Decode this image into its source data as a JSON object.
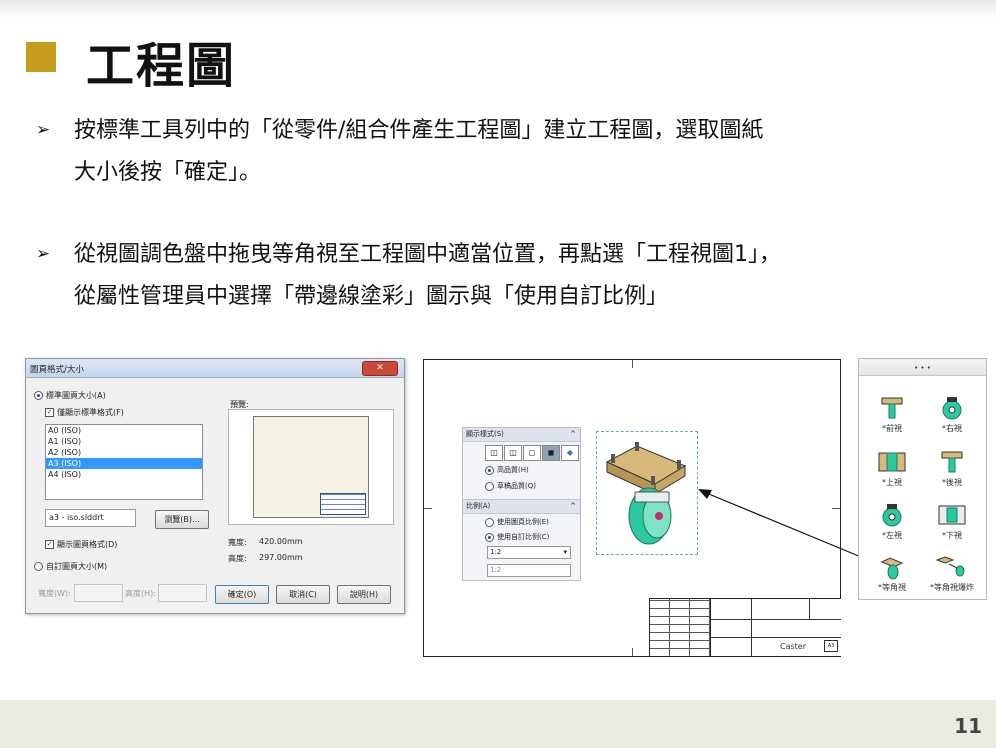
{
  "slide": {
    "title": "工程圖",
    "bullets": [
      {
        "line1": "按標準工具列中的「從零件/組合件產生工程圖」建立工程圖，選取圖紙",
        "line2": "大小後按「確定」。"
      },
      {
        "line1": "從視圖調色盤中拖曳等角視至工程圖中適當位置，再點選「工程視圖1」，",
        "line2": "從屬性管理員中選擇「帶邊線塗彩」圖示與「使用自訂比例」"
      }
    ],
    "bullet_glyph": "➢",
    "page_number": "11"
  },
  "dialog": {
    "title": "圖頁格式/大小",
    "standard_size_label": "標準圖頁大小(A)",
    "only_standard_label": "僅顯示標準格式(F)",
    "sizes": [
      "A0 (ISO)",
      "A1 (ISO)",
      "A2 (ISO)",
      "A3 (ISO)",
      "A4 (ISO)"
    ],
    "selected_index": 3,
    "preview_label": "預覽:",
    "format_file": "a3 - iso.slddrt",
    "browse_label": "瀏覽(B)...",
    "show_format_label": "顯示圖頁格式(D)",
    "width_label": "寬度:",
    "width_value": "420.00mm",
    "height_label": "高度:",
    "height_value": "297.00mm",
    "custom_size_label": "自訂圖頁大小(M)",
    "custom_width_label": "寬度(W):",
    "custom_height_label": "高度(H):",
    "ok_label": "確定(O)",
    "cancel_label": "取消(C)",
    "help_label": "說明(H)",
    "close_glyph": "✕"
  },
  "display_panel": {
    "display_style_header": "顯示樣式(S)",
    "high_quality": "高品質(H)",
    "draft_quality": "草稿品質(Q)",
    "scale_header": "比例(A)",
    "use_sheet_scale": "使用圖頁比例(E)",
    "use_custom_scale": "使用自訂比例(C)",
    "scale_select": "1:2",
    "scale_field": "1:2",
    "chevron": "^"
  },
  "title_block": {
    "part_name": "Caster",
    "size": "A3"
  },
  "view_palette": {
    "views": [
      {
        "label": "*前視"
      },
      {
        "label": "*右視"
      },
      {
        "label": "*上視"
      },
      {
        "label": "*後視"
      },
      {
        "label": "*左視"
      },
      {
        "label": "*下視"
      },
      {
        "label": "*等角視"
      },
      {
        "label": "*等角視爆炸"
      }
    ]
  },
  "colors": {
    "accent_square": "#c69c1e",
    "wheel_green": "#2cc8a0",
    "bracket_tan": "#d9b97a",
    "footer_band": "#ebebdf"
  }
}
